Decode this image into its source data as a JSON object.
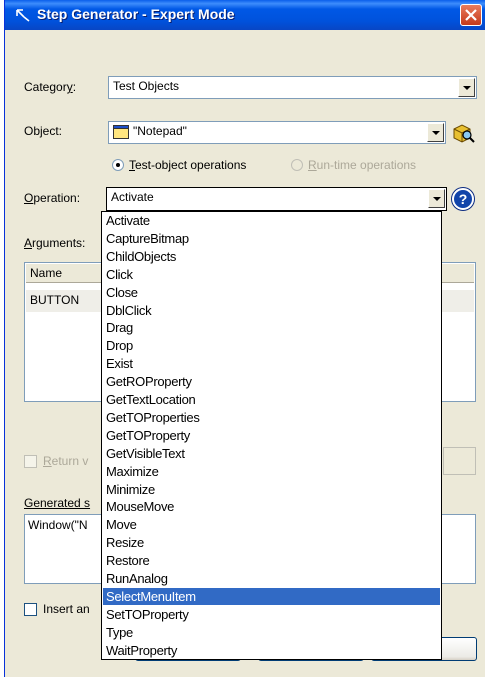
{
  "window": {
    "title": "Step Generator - Expert Mode"
  },
  "category": {
    "label_pre": "Categor",
    "label_u": "y",
    "label_post": ":",
    "value": "Test Objects"
  },
  "object": {
    "label": "Object:",
    "value": "\"Notepad\""
  },
  "radios": {
    "test_pre": "",
    "test_u": "T",
    "test_post": "est-object operations",
    "runtime_pre": "",
    "runtime_u": "R",
    "runtime_post": "un-time operations"
  },
  "operation": {
    "label_u": "O",
    "label_post": "peration:",
    "value": "Activate"
  },
  "arguments": {
    "label_u": "A",
    "label_post": "rguments:"
  },
  "grid": {
    "col_name": "Name",
    "row1_name": "BUTTON"
  },
  "return_value": {
    "label_u": "R",
    "label_post": "eturn v"
  },
  "generated": {
    "label": "Generated s",
    "text": "Window(\"N"
  },
  "insert": {
    "label": "Insert an"
  },
  "operation_list": [
    "Activate",
    "CaptureBitmap",
    "ChildObjects",
    "Click",
    "Close",
    "DblClick",
    "Drag",
    "Drop",
    "Exist",
    "GetROProperty",
    "GetTextLocation",
    "GetTOProperties",
    "GetTOProperty",
    "GetVisibleText",
    "Maximize",
    "Minimize",
    "MouseMove",
    "Move",
    "Resize",
    "Restore",
    "RunAnalog",
    "SelectMenuItem",
    "SetTOProperty",
    "Type",
    "WaitProperty"
  ],
  "selected_operation_index": 21,
  "colors": {
    "selection": "#316AC5",
    "titlebar": "#0058E6",
    "dialog": "#ECE9D8"
  }
}
